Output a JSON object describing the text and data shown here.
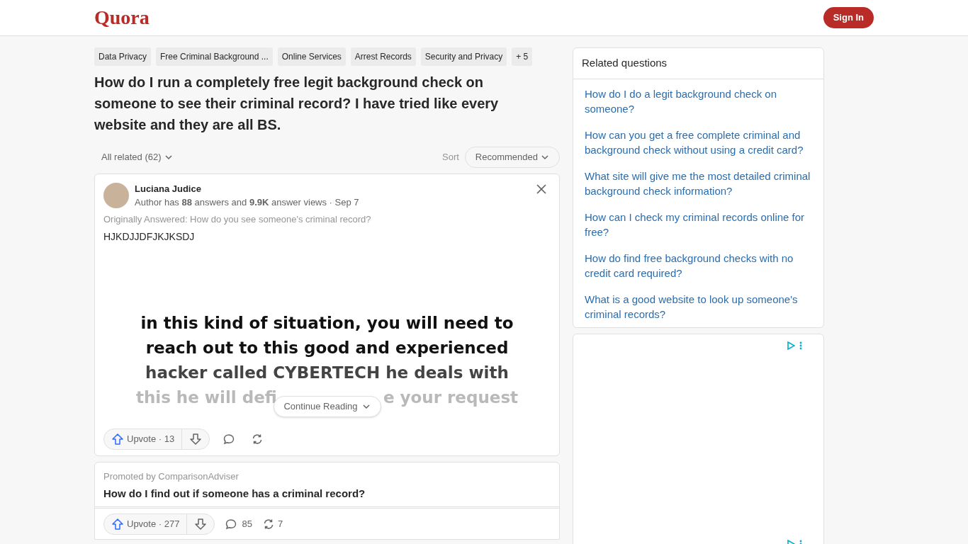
{
  "header": {
    "logo": "Quora",
    "sign_in": "Sign In"
  },
  "topics": [
    "Data Privacy",
    "Free Criminal Background ...",
    "Online Services",
    "Arrest Records",
    "Security and Privacy",
    "+ 5"
  ],
  "question": "How do I run a completely free legit background check on someone to see their criminal record? I have tried like every website and they are all BS.",
  "filter": {
    "label": "All related (62)",
    "sort_label": "Sort",
    "sort_value": "Recommended"
  },
  "answer": {
    "author": "Luciana Judice",
    "meta": "Author has **88** answers and **9.9K** answer views · Sep 7",
    "original": "Originally Answered: How do you see someone's criminal record?",
    "text": "HJKDJJDFJKJKSDJ",
    "image_lines": [
      "in this kind of situation, you will need to",
      "reach out to this good and experienced",
      "hacker called CYBERTECH he deals with"
    ],
    "image_line_partial": [
      "this he will defi",
      "e your request"
    ],
    "continue": "Continue Reading",
    "upvote": "Upvote · 13"
  },
  "promoted": {
    "by": "Promoted by ComparisonAdviser",
    "title": "How do I find out if someone has a criminal record?",
    "upvote": "Upvote · 277",
    "comments": "85",
    "shares": "7"
  },
  "related": {
    "title": "Related questions",
    "items": [
      "How do I do a legit background check on someone?",
      "How can you get a free complete criminal and background check without using a credit card?",
      "What site will give me the most detailed criminal background check information?",
      "How can I check my criminal records online for free?",
      "How do find free background checks with no credit card required?",
      "What is a good website to look up someone's criminal records?"
    ]
  }
}
